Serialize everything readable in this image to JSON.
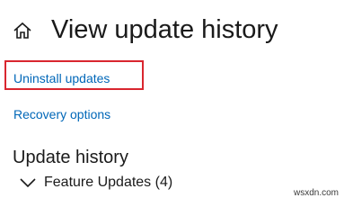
{
  "header": {
    "home_icon": "home-icon",
    "title": "View update history"
  },
  "links": {
    "uninstall_updates": "Uninstall updates",
    "recovery_options": "Recovery options"
  },
  "annotation": {
    "highlight_color": "#d9262f"
  },
  "update_history": {
    "heading": "Update history",
    "groups": [
      {
        "label": "Feature Updates (4)",
        "expanded": true,
        "icon": "chevron-down-icon"
      }
    ]
  },
  "watermark": "wsxdn.com",
  "colors": {
    "link": "#0067b8",
    "text": "#1a1a1a",
    "background": "#ffffff"
  }
}
